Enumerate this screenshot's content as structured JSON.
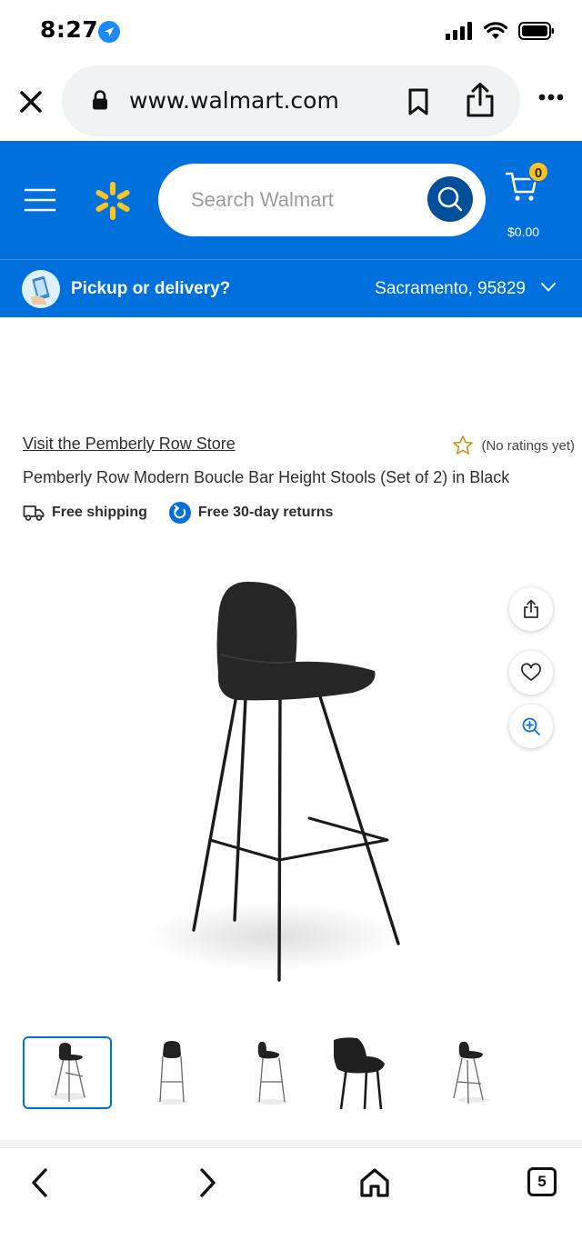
{
  "status_bar": {
    "time": "8:27"
  },
  "browser": {
    "url": "www.walmart.com",
    "open_tabs": "5"
  },
  "header": {
    "search_placeholder": "Search Walmart",
    "cart_count": "0",
    "cart_total": "$0.00",
    "brand_color": "#0071dc",
    "spark_color": "#ffc220"
  },
  "pickup": {
    "label": "Pickup or delivery?",
    "location": "Sacramento, 95829"
  },
  "product": {
    "store_link": "Visit the Pemberly Row Store",
    "rating_text": "(No ratings yet)",
    "title": "Pemberly Row Modern Boucle Bar Height Stools (Set of 2) in Black",
    "badges": [
      "Free shipping",
      "Free 30-day returns"
    ],
    "image_icon": "bar-stool-image",
    "thumbnail_count": 5,
    "selected_thumbnail": 0
  },
  "icons": {
    "close": "close-icon",
    "lock": "lock-icon",
    "bookmark": "bookmark-icon",
    "share": "share-icon",
    "more": "more-icon",
    "menu": "menu-icon",
    "search": "search-icon",
    "cart": "cart-icon",
    "star": "star-icon",
    "truck": "truck-icon",
    "returns": "returns-icon",
    "heart": "heart-icon",
    "zoom": "zoom-in-icon",
    "back": "back-icon",
    "forward": "forward-icon",
    "home": "home-icon"
  }
}
